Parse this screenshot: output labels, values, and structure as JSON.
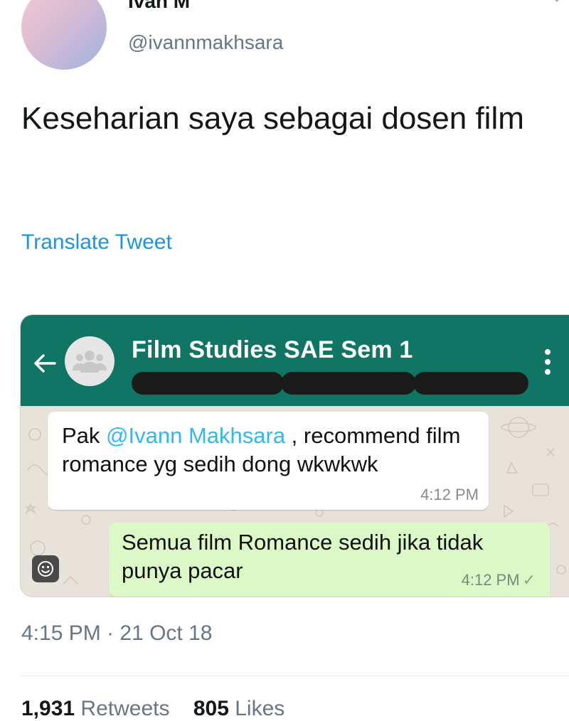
{
  "tweet": {
    "author_name": "Ivan M",
    "author_handle": "@ivannmakhsara",
    "text": "Keseharian saya sebagai dosen film",
    "translate_label": "Translate Tweet",
    "timestamp": "4:15 PM · 21 Oct 18",
    "retweets_count": "1,931",
    "retweets_label": "Retweets",
    "likes_count": "805",
    "likes_label": "Likes"
  },
  "whatsapp": {
    "group_title": "Film Studies SAE Sem 1",
    "header_color": "#117566",
    "incoming": {
      "prefix": "Pak ",
      "mention": "@Ivann Makhsara",
      "rest": " , recommend film romance yg sedih dong wkwkwk",
      "time": "4:12 PM"
    },
    "outgoing": {
      "text": "Semua film Romance sedih jika tidak punya pacar",
      "time": "4:12 PM",
      "status_icon": "✓"
    }
  },
  "icons": {
    "caret": "chevron-down-icon",
    "back": "arrow-left-icon",
    "group": "group-avatar-icon",
    "menu": "more-vertical-icon",
    "emoji": "emoji-icon"
  },
  "colors": {
    "link_blue": "#1b95e0",
    "mention_blue": "#34b7f1",
    "outgoing_bubble": "#dcf8c6"
  }
}
